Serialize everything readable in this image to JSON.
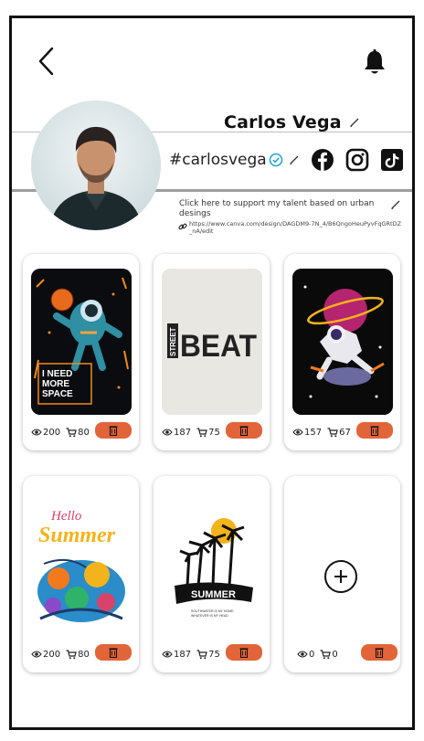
{
  "profile": {
    "name": "Carlos Vega",
    "handle": "#carlosvega",
    "support_text": "Click here to support my talent based on urban desings",
    "support_link": "https://www.canva.com/design/DAGDM9-7N_4/B6QngoHeuPyvFqGRtDZ_nA/edit"
  },
  "icons": {
    "back": "chevron-left-icon",
    "bell": "bell-icon",
    "facebook": "facebook-icon",
    "instagram": "instagram-icon",
    "tiktok": "tiktok-icon",
    "verified": "verified-badge-icon",
    "edit": "pencil-icon",
    "link": "link-icon",
    "views": "eye-icon",
    "sales": "cart-icon",
    "delete": "trash-icon",
    "add": "plus-icon"
  },
  "colors": {
    "accent": "#e2653a",
    "verified": "#2aa3d6"
  },
  "designs": [
    {
      "views": "200",
      "sales": "80",
      "text": [
        "I NEED",
        "MORE",
        "SPACE"
      ]
    },
    {
      "views": "187",
      "sales": "75",
      "text": [
        "STREET",
        "BEAT"
      ]
    },
    {
      "views": "157",
      "sales": "67"
    },
    {
      "views": "200",
      "sales": "80",
      "text": [
        "Hello",
        "Summer"
      ]
    },
    {
      "views": "187",
      "sales": "75",
      "text": [
        "SUMMER",
        "SOUTHWATER IS MY HOME,",
        "WHATEVER IS MY HEAD"
      ]
    },
    {
      "views": "0",
      "sales": "0"
    }
  ]
}
